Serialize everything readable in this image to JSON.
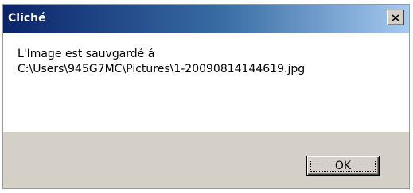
{
  "window": {
    "title": "Cliché",
    "close_icon": "close-icon"
  },
  "message": {
    "line1": "L'Image est sauvgardé á",
    "line2": "C:\\Users\\945G7MC\\Pictures\\1-20090814144619.jpg"
  },
  "buttons": {
    "ok_label": "OK"
  },
  "colors": {
    "title_start": "#0a246a",
    "title_end": "#a6caf0",
    "footer_bg": "#d4d0c8",
    "body_bg": "#ffffff"
  }
}
